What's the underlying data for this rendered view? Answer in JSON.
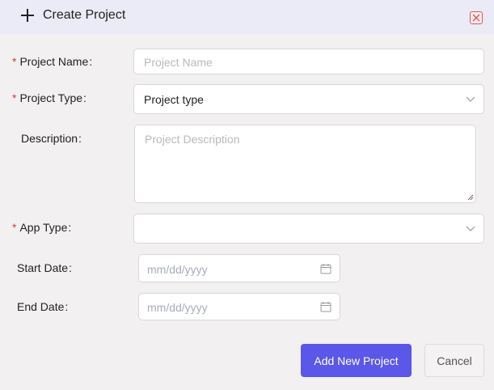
{
  "dialog": {
    "title": "Create Project",
    "header_icon": "plus-icon",
    "close_icon": "close-icon"
  },
  "form": {
    "project_name": {
      "label": "Project Name",
      "required": true,
      "placeholder": "Project Name",
      "value": ""
    },
    "project_type": {
      "label": "Project Type",
      "required": true,
      "selected": "Project type",
      "icon": "chevron-down-icon"
    },
    "description": {
      "label": "Description",
      "required": false,
      "placeholder": "Project Description",
      "value": ""
    },
    "app_type": {
      "label": "App Type",
      "required": true,
      "selected": "",
      "icon": "chevron-down-icon"
    },
    "start_date": {
      "label": "Start Date",
      "placeholder": "mm/dd/yyyy",
      "icon": "calendar-icon"
    },
    "end_date": {
      "label": "End Date",
      "placeholder": "mm/dd/yyyy",
      "icon": "calendar-icon"
    },
    "colon": ":",
    "required_marker": "*"
  },
  "actions": {
    "primary_label": "Add New Project",
    "secondary_label": "Cancel"
  },
  "colors": {
    "header_bg": "#ebebf8",
    "primary": "#5b57e8",
    "required": "#d9363e",
    "close_red": "#e05555"
  }
}
